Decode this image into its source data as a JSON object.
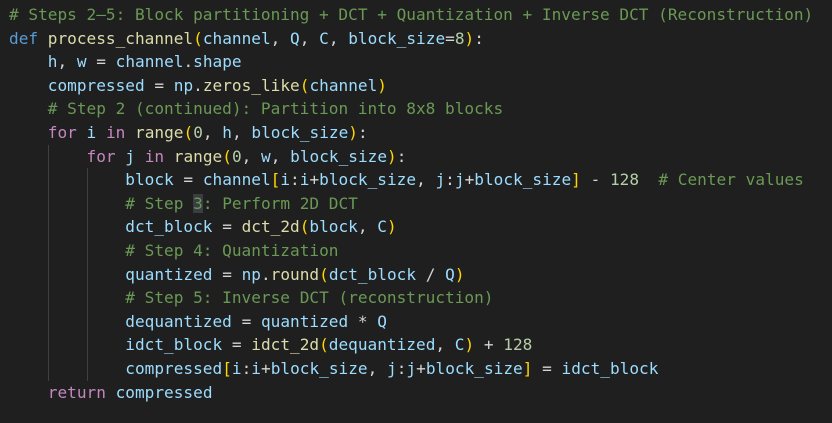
{
  "editor": {
    "lines": [
      {
        "indent": 0,
        "tokens": [
          {
            "t": "# Steps 2–5: Block partitioning + DCT + Quantization + Inverse DCT (Reconstruction)",
            "c": "cmt"
          }
        ]
      },
      {
        "indent": 0,
        "tokens": [
          {
            "t": "def",
            "c": "kw"
          },
          {
            "t": " ",
            "c": "op"
          },
          {
            "t": "process_channel",
            "c": "fn"
          },
          {
            "t": "(",
            "c": "b1"
          },
          {
            "t": "channel",
            "c": "var"
          },
          {
            "t": ", ",
            "c": "op"
          },
          {
            "t": "Q",
            "c": "var"
          },
          {
            "t": ", ",
            "c": "op"
          },
          {
            "t": "C",
            "c": "var"
          },
          {
            "t": ", ",
            "c": "op"
          },
          {
            "t": "block_size",
            "c": "var"
          },
          {
            "t": "=",
            "c": "op"
          },
          {
            "t": "8",
            "c": "num"
          },
          {
            "t": ")",
            "c": "b1"
          },
          {
            "t": ":",
            "c": "op"
          }
        ]
      },
      {
        "indent": 1,
        "tokens": [
          {
            "t": "h",
            "c": "var"
          },
          {
            "t": ", ",
            "c": "op"
          },
          {
            "t": "w",
            "c": "var"
          },
          {
            "t": " = ",
            "c": "op"
          },
          {
            "t": "channel",
            "c": "var"
          },
          {
            "t": ".",
            "c": "op"
          },
          {
            "t": "shape",
            "c": "var"
          }
        ]
      },
      {
        "indent": 1,
        "tokens": [
          {
            "t": "compressed",
            "c": "var"
          },
          {
            "t": " = ",
            "c": "op"
          },
          {
            "t": "np",
            "c": "var"
          },
          {
            "t": ".",
            "c": "op"
          },
          {
            "t": "zeros_like",
            "c": "fn"
          },
          {
            "t": "(",
            "c": "b1"
          },
          {
            "t": "channel",
            "c": "var"
          },
          {
            "t": ")",
            "c": "b1"
          }
        ]
      },
      {
        "indent": 1,
        "tokens": [
          {
            "t": "# Step 2 (continued): Partition into 8x8 blocks",
            "c": "cmt"
          }
        ]
      },
      {
        "indent": 1,
        "tokens": [
          {
            "t": "for",
            "c": "ctl"
          },
          {
            "t": " ",
            "c": "op"
          },
          {
            "t": "i",
            "c": "var"
          },
          {
            "t": " ",
            "c": "op"
          },
          {
            "t": "in",
            "c": "ctl"
          },
          {
            "t": " ",
            "c": "op"
          },
          {
            "t": "range",
            "c": "fn"
          },
          {
            "t": "(",
            "c": "b1"
          },
          {
            "t": "0",
            "c": "num"
          },
          {
            "t": ", ",
            "c": "op"
          },
          {
            "t": "h",
            "c": "var"
          },
          {
            "t": ", ",
            "c": "op"
          },
          {
            "t": "block_size",
            "c": "var"
          },
          {
            "t": ")",
            "c": "b1"
          },
          {
            "t": ":",
            "c": "op"
          }
        ]
      },
      {
        "indent": 2,
        "tokens": [
          {
            "t": "for",
            "c": "ctl"
          },
          {
            "t": " ",
            "c": "op"
          },
          {
            "t": "j",
            "c": "var"
          },
          {
            "t": " ",
            "c": "op"
          },
          {
            "t": "in",
            "c": "ctl"
          },
          {
            "t": " ",
            "c": "op"
          },
          {
            "t": "range",
            "c": "fn"
          },
          {
            "t": "(",
            "c": "b1"
          },
          {
            "t": "0",
            "c": "num"
          },
          {
            "t": ", ",
            "c": "op"
          },
          {
            "t": "w",
            "c": "var"
          },
          {
            "t": ", ",
            "c": "op"
          },
          {
            "t": "block_size",
            "c": "var"
          },
          {
            "t": ")",
            "c": "b1"
          },
          {
            "t": ":",
            "c": "op"
          }
        ]
      },
      {
        "indent": 3,
        "tokens": [
          {
            "t": "block",
            "c": "var"
          },
          {
            "t": " = ",
            "c": "op"
          },
          {
            "t": "channel",
            "c": "var"
          },
          {
            "t": "[",
            "c": "b1"
          },
          {
            "t": "i",
            "c": "var"
          },
          {
            "t": ":",
            "c": "op"
          },
          {
            "t": "i",
            "c": "var"
          },
          {
            "t": "+",
            "c": "op"
          },
          {
            "t": "block_size",
            "c": "var"
          },
          {
            "t": ", ",
            "c": "op"
          },
          {
            "t": "j",
            "c": "var"
          },
          {
            "t": ":",
            "c": "op"
          },
          {
            "t": "j",
            "c": "var"
          },
          {
            "t": "+",
            "c": "op"
          },
          {
            "t": "block_size",
            "c": "var"
          },
          {
            "t": "]",
            "c": "b1"
          },
          {
            "t": " - ",
            "c": "op"
          },
          {
            "t": "128",
            "c": "num"
          },
          {
            "t": "  ",
            "c": "op"
          },
          {
            "t": "# Center values",
            "c": "cmt"
          }
        ]
      },
      {
        "indent": 3,
        "tokens": [
          {
            "t": "# Step ",
            "c": "cmt"
          },
          {
            "t": "3",
            "c": "cmt",
            "hl": true
          },
          {
            "t": ": Perform 2D DCT",
            "c": "cmt"
          }
        ]
      },
      {
        "indent": 3,
        "tokens": [
          {
            "t": "dct_block",
            "c": "var"
          },
          {
            "t": " = ",
            "c": "op"
          },
          {
            "t": "dct_2d",
            "c": "fn"
          },
          {
            "t": "(",
            "c": "b1"
          },
          {
            "t": "block",
            "c": "var"
          },
          {
            "t": ", ",
            "c": "op"
          },
          {
            "t": "C",
            "c": "var"
          },
          {
            "t": ")",
            "c": "b1"
          }
        ]
      },
      {
        "indent": 3,
        "tokens": [
          {
            "t": "# Step 4: Quantization",
            "c": "cmt"
          }
        ]
      },
      {
        "indent": 3,
        "tokens": [
          {
            "t": "quantized",
            "c": "var"
          },
          {
            "t": " = ",
            "c": "op"
          },
          {
            "t": "np",
            "c": "var"
          },
          {
            "t": ".",
            "c": "op"
          },
          {
            "t": "round",
            "c": "fn"
          },
          {
            "t": "(",
            "c": "b1"
          },
          {
            "t": "dct_block",
            "c": "var"
          },
          {
            "t": " / ",
            "c": "op"
          },
          {
            "t": "Q",
            "c": "var"
          },
          {
            "t": ")",
            "c": "b1"
          }
        ]
      },
      {
        "indent": 3,
        "tokens": [
          {
            "t": "# Step 5: Inverse DCT (reconstruction)",
            "c": "cmt"
          }
        ]
      },
      {
        "indent": 3,
        "tokens": [
          {
            "t": "dequantized",
            "c": "var"
          },
          {
            "t": " = ",
            "c": "op"
          },
          {
            "t": "quantized",
            "c": "var"
          },
          {
            "t": " * ",
            "c": "op"
          },
          {
            "t": "Q",
            "c": "var"
          }
        ]
      },
      {
        "indent": 3,
        "tokens": [
          {
            "t": "idct_block",
            "c": "var"
          },
          {
            "t": " = ",
            "c": "op"
          },
          {
            "t": "idct_2d",
            "c": "fn"
          },
          {
            "t": "(",
            "c": "b1"
          },
          {
            "t": "dequantized",
            "c": "var"
          },
          {
            "t": ", ",
            "c": "op"
          },
          {
            "t": "C",
            "c": "var"
          },
          {
            "t": ")",
            "c": "b1"
          },
          {
            "t": " + ",
            "c": "op"
          },
          {
            "t": "128",
            "c": "num"
          }
        ]
      },
      {
        "indent": 3,
        "tokens": [
          {
            "t": "compressed",
            "c": "var"
          },
          {
            "t": "[",
            "c": "b1"
          },
          {
            "t": "i",
            "c": "var"
          },
          {
            "t": ":",
            "c": "op"
          },
          {
            "t": "i",
            "c": "var"
          },
          {
            "t": "+",
            "c": "op"
          },
          {
            "t": "block_size",
            "c": "var"
          },
          {
            "t": ", ",
            "c": "op"
          },
          {
            "t": "j",
            "c": "var"
          },
          {
            "t": ":",
            "c": "op"
          },
          {
            "t": "j",
            "c": "var"
          },
          {
            "t": "+",
            "c": "op"
          },
          {
            "t": "block_size",
            "c": "var"
          },
          {
            "t": "]",
            "c": "b1"
          },
          {
            "t": " = ",
            "c": "op"
          },
          {
            "t": "idct_block",
            "c": "var"
          }
        ]
      },
      {
        "indent": 1,
        "tokens": [
          {
            "t": "return",
            "c": "ctl"
          },
          {
            "t": " ",
            "c": "op"
          },
          {
            "t": "compressed",
            "c": "var"
          }
        ]
      }
    ]
  }
}
